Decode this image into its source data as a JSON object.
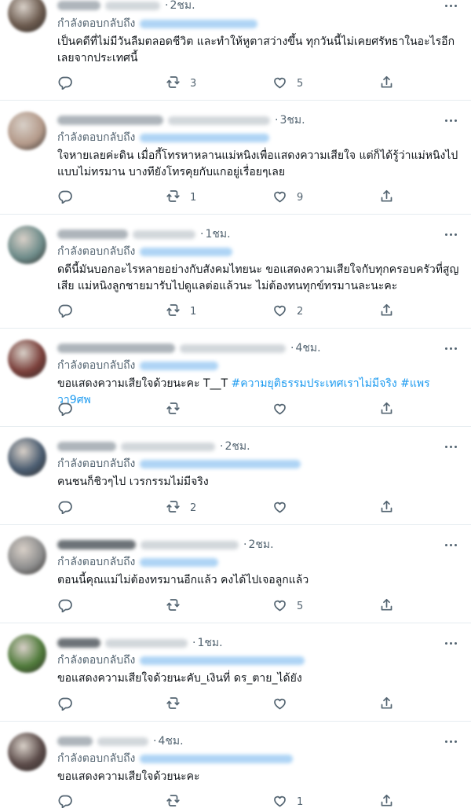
{
  "replying_label": "กำลังตอบกลับถึง",
  "tweets": [
    {
      "time": "2ชม.",
      "text": "เป็นคดีที่ไม่มีวันลืมตลอดชีวิต และทำให้หูตาสว่างขึ้น ทุกวันนี้ไม่เคยศรัทธาในอะไรอีกเลยจากประเทศนี้",
      "hashtags": "",
      "replies": "",
      "retweets": "3",
      "likes": "5",
      "avatar_color": "#6b5a4e"
    },
    {
      "time": "3ชม.",
      "text": "ใจหายเลยค่ะดิน เมื่อกี้โทรหาหลานแม่หนิงเพื่อแสดงความเสียใจ แต่ก็ได้รู้ว่าแม่หนิงไปแบบไม่ทรมาน บางทียังโทรคุยกับแกอยู่เรื่อยๆเลย",
      "hashtags": "",
      "replies": "",
      "retweets": "1",
      "likes": "9",
      "avatar_color": "#b49a8a"
    },
    {
      "time": "1ชม.",
      "text": "ดดีนี้มันบอกอะไรหลายอย่างกับสังคมไทยนะ ขอแสดงความเสียใจกับทุกครอบครัวที่สูญเสีย แม่หนิงลูกชายมารับไปดูแลต่อแล้วนะ ไม่ต้องทนทุกข์ทรมานละนะคะ",
      "hashtags": "",
      "replies": "",
      "retweets": "1",
      "likes": "2",
      "avatar_color": "#6e8c8a"
    },
    {
      "time": "4ชม.",
      "text": "ขอแสดงความเสียใจด้วยนะคะ T__T ",
      "hashtags": "#ความยุติธรรมประเทศเราไม่มีจริง #แพรวา9ศพ",
      "replies": "",
      "retweets": "",
      "likes": "",
      "avatar_color": "#7a3f3a"
    },
    {
      "time": "2ชม.",
      "text": "คนชนก็ชิวๆไป เวรกรรมไม่มีจริง",
      "hashtags": "",
      "replies": "",
      "retweets": "2",
      "likes": "",
      "avatar_color": "#4a5c70"
    },
    {
      "time": "2ชม.",
      "text": "ตอนนี้คุณแม่ไม่ต้องทรมานอีกแล้ว คงได้ไปเจอลูกแล้ว",
      "hashtags": "",
      "replies": "",
      "retweets": "",
      "likes": "5",
      "avatar_color": "#8d8d8d"
    },
    {
      "time": "1ชม.",
      "text": "ขอแสดงความเสียใจด้วยนะคับ_เงินที่ ดร_ตาย_ได้ยัง",
      "hashtags": "",
      "replies": "",
      "retweets": "",
      "likes": "",
      "avatar_color": "#4f7a3a"
    },
    {
      "time": "4ชม.",
      "text": "ขอแสดงความเสียใจด้วยนะคะ",
      "hashtags": "",
      "replies": "",
      "retweets": "",
      "likes": "1",
      "avatar_color": "#5a4a48"
    }
  ]
}
